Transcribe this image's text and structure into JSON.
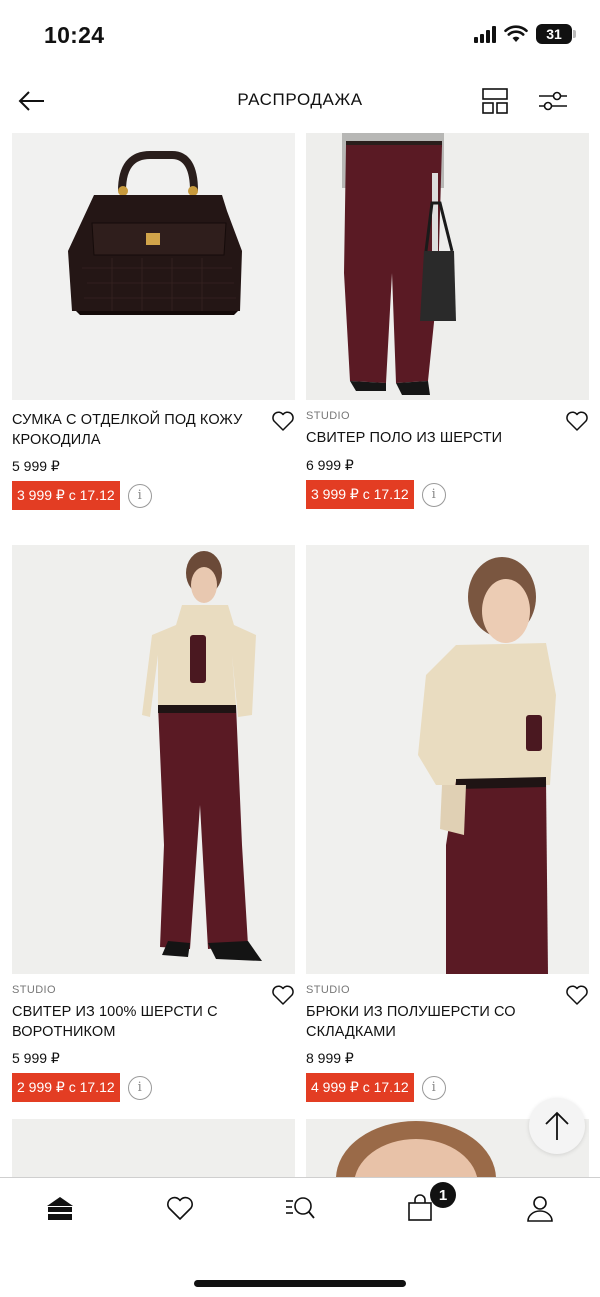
{
  "status_bar": {
    "time": "10:24",
    "battery": "31"
  },
  "header": {
    "title": "РАСПРОДАЖА"
  },
  "products": [
    {
      "brand": "",
      "name": "СУМКА С ОТДЕЛКОЙ ПОД КОЖУ КРОКОДИЛА",
      "old_price": "5 999 ₽",
      "sale_price": "3 999 ₽ с 17.12"
    },
    {
      "brand": "STUDIO",
      "name": "СВИТЕР ПОЛО ИЗ ШЕРСТИ",
      "old_price": "6 999 ₽",
      "sale_price": "3 999 ₽ с 17.12"
    },
    {
      "brand": "STUDIO",
      "name": "СВИТЕР ИЗ 100% ШЕРСТИ С ВОРОТНИКОМ",
      "old_price": "5 999 ₽",
      "sale_price": "2 999 ₽ с 17.12"
    },
    {
      "brand": "STUDIO",
      "name": "БРЮКИ ИЗ ПОЛУШЕРСТИ СО СКЛАДКАМИ",
      "old_price": "8 999 ₽",
      "sale_price": "4 999 ₽ с 17.12"
    }
  ],
  "info_icon_glyph": "i",
  "tabbar": {
    "cart_count": "1",
    "items": [
      "home-icon",
      "heart-icon",
      "search-list-icon",
      "bag-icon",
      "profile-icon"
    ]
  },
  "colors": {
    "sale": "#e33d23",
    "trousers": "#5a1a24",
    "sweater": "#e9dcc0"
  }
}
